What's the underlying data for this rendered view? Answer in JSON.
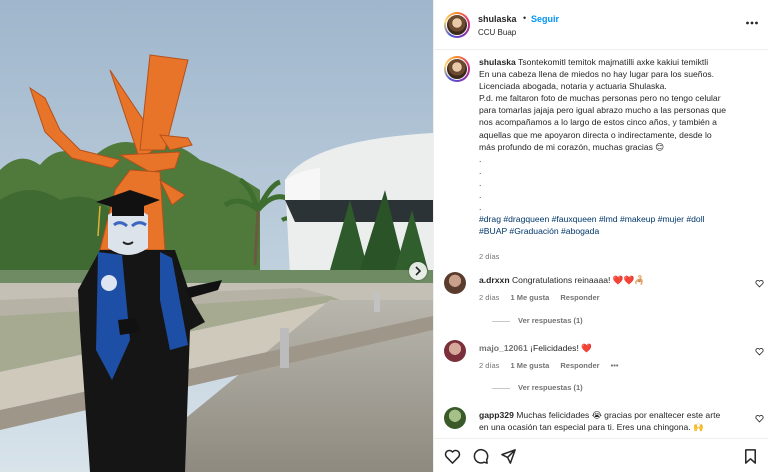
{
  "post": {
    "username": "shulaska",
    "separator": "•",
    "follow_label": "Seguir",
    "location": "CCU Buap",
    "more_icon": "more-horizontal-icon",
    "caption_lines": [
      "Tsontekomitl temitok majmatilli axke kakiui temiktli",
      "En una cabeza llena de miedos no hay lugar para los sueños.",
      "Licenciada abogada, notaria y actuaria Shulaska.",
      "P.d. me faltaron foto de muchas personas pero no tengo celular",
      "para tomarlas jajaja pero igual abrazo mucho a las personas que",
      "nos acompañamos a lo largo de estos cinco años, y también a",
      "aquellas que me apoyaron directa o indirectamente, desde lo",
      "más profundo de mi corazón, muchas gracias 😊",
      ".",
      ".",
      ".",
      ".",
      "."
    ],
    "hashtags_line1": "#drag #dragqueen #fauxqueen #lmd #makeup #mujer #doll",
    "hashtags_line2": "#BUAP #Graduación #abogada",
    "time": "2 días"
  },
  "comments": [
    {
      "username": "a.drxxn",
      "text": "Congratulations reinaaaa! ❤️❤️🦂",
      "time": "2 días",
      "likes": "1 Me gusta",
      "reply_label": "Responder",
      "view_replies": "Ver respuestas (1)"
    },
    {
      "username": "majo_12061",
      "text": "¡Felicidades! ❤️",
      "time": "2 días",
      "likes": "1 Me gusta",
      "reply_label": "Responder",
      "more": "•••",
      "view_replies": "Ver respuestas (1)"
    },
    {
      "username": "gapp329",
      "text": "Muchas felicidades 😭 gracias por enaltecer este arte",
      "text2": "en una ocasión tan especial para ti. Eres una chingona. 🙌"
    }
  ],
  "action_icons": [
    "heart-icon",
    "comment-icon",
    "share-icon",
    "bookmark-icon"
  ],
  "colors": {
    "link": "#0095f6",
    "hashtag": "#00376b",
    "muted": "#737373",
    "sculpture": "#e8742a"
  }
}
